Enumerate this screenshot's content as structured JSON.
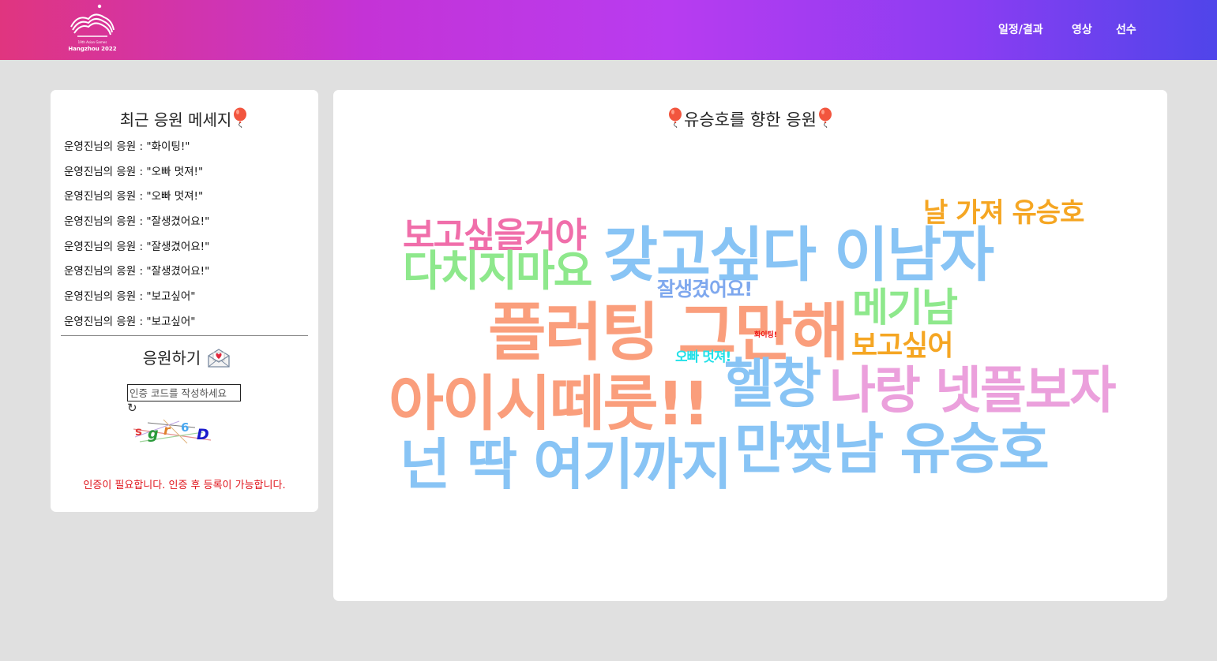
{
  "header": {
    "logo_line1": "19th Asian Games",
    "logo_line2": "Hangzhou 2022",
    "nav": [
      "일정/결과",
      "영상",
      "선수"
    ]
  },
  "recent": {
    "title": "최근 응원 메세지",
    "messages": [
      "운영진님의 응원 : \"화이팅!\"",
      "운영진님의 응원 : \"오빠 멋져!\"",
      "운영진님의 응원 : \"오빠 멋져!\"",
      "운영진님의 응원 : \"잘생겼어요!\"",
      "운영진님의 응원 : \"잘생겼어요!\"",
      "운영진님의 응원 : \"잘생겼어요!\"",
      "운영진님의 응원 : \"보고싶어\"",
      "운영진님의 응원 : \"보고싶어\""
    ]
  },
  "cheer": {
    "title": "응원하기",
    "placeholder": "인증 코드를 작성하세요",
    "captcha": [
      "s",
      "g",
      "r",
      "6",
      "D"
    ],
    "auth_note": "인증이 필요합니다. 인증 후 등록이 가능합니다."
  },
  "cloud": {
    "title": "유승호를 향한 응원",
    "words": [
      {
        "text": "날 가져 유승호",
        "color": "#f5a623"
      },
      {
        "text": "보고싶을거야",
        "color": "#f06eaa"
      },
      {
        "text": "갖고싶다 이남자",
        "color": "#88c4f5"
      },
      {
        "text": "다치지마요",
        "color": "#8ee88c"
      },
      {
        "text": "잘생겼어요!",
        "color": "#7fa8ee"
      },
      {
        "text": "메기남",
        "color": "#8ee88c"
      },
      {
        "text": "플러팅 그만해",
        "color": "#fa9e7c"
      },
      {
        "text": "화이팅!",
        "color": "#ee1111"
      },
      {
        "text": "보고싶어",
        "color": "#f5a623"
      },
      {
        "text": "오빠 멋져!",
        "color": "#22e0e8"
      },
      {
        "text": "헬창",
        "color": "#88c4f5"
      },
      {
        "text": "나랑 넷플보자",
        "color": "#eba0dc"
      },
      {
        "text": "아이시떼룻!!",
        "color": "#fa9e7c"
      },
      {
        "text": "만찢남 유승호",
        "color": "#88c4f5"
      },
      {
        "text": "넌 딱 여기까지",
        "color": "#88c4f5"
      }
    ]
  }
}
